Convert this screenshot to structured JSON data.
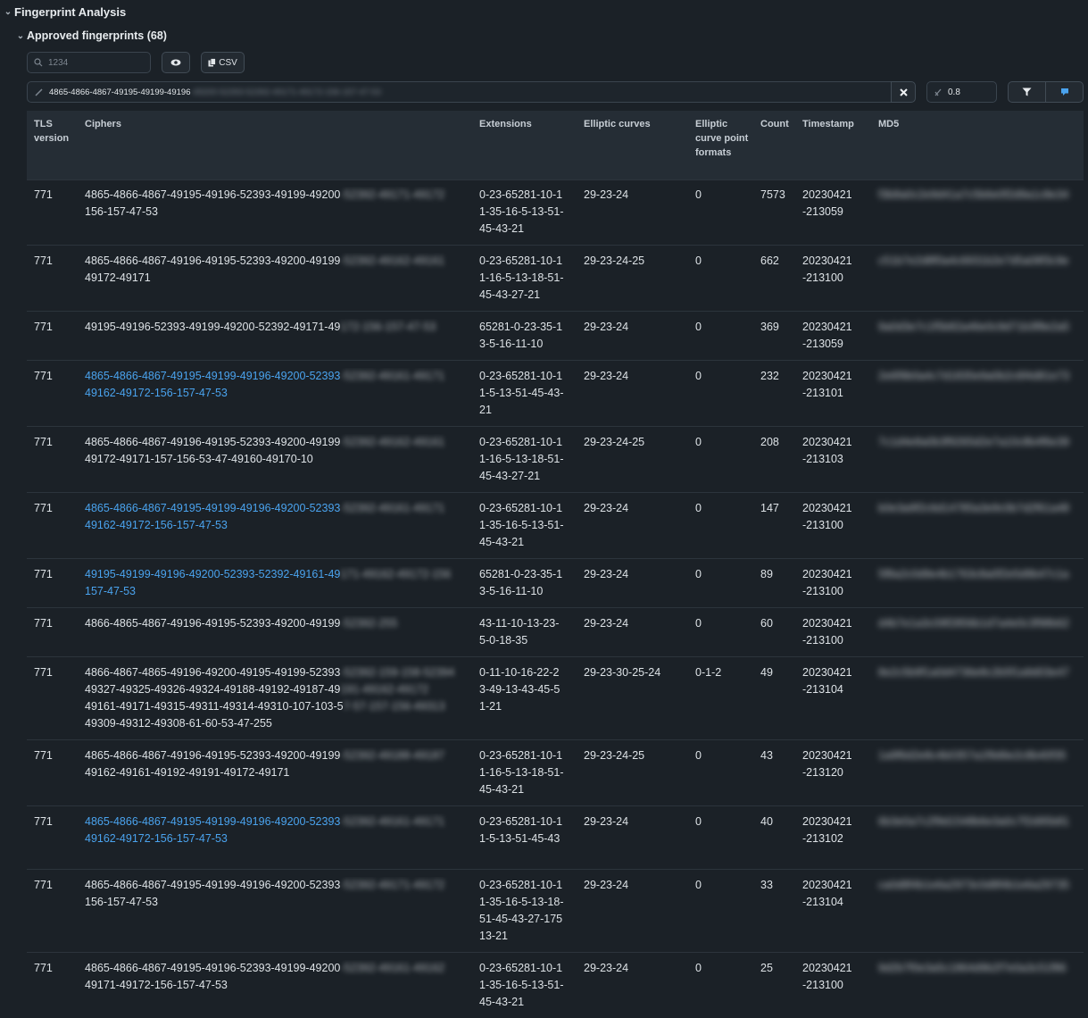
{
  "panel": {
    "title": "Fingerprint Analysis"
  },
  "subpanel": {
    "title": "Approved fingerprints (68)"
  },
  "toolbar": {
    "search_placeholder": "1234",
    "csv_label": "CSV",
    "filter_value": "4865-4866-4867-49195-49199-49196",
    "filter_value_hidden": "-49200-52393-52392-49171-49172-156-157-47-53",
    "threshold_value": "0.8"
  },
  "table": {
    "columns": [
      "TLS version",
      "Ciphers",
      "Extensions",
      "Elliptic curves",
      "Elliptic curve point formats",
      "Count",
      "Timestamp",
      "MD5"
    ],
    "rows": [
      {
        "tls": "771",
        "ciphers": [
          "4865-4866-4867-49195-49196-52393-49199-49200",
          "156-157-47-53"
        ],
        "cipher_hidden": [
          "-52392-49171-49172"
        ],
        "link": false,
        "ext": "0-23-65281-10-11-35-16-5-13-51-45-43-21",
        "curves": "29-23-24",
        "pf": "0",
        "count": "7573",
        "ts": "20230421-213059",
        "md5": "f3b8a0c2e9d41a7c5b6e0f2d9a1c8e34"
      },
      {
        "tls": "771",
        "ciphers": [
          "4865-4866-4867-49196-49195-52393-49200-49199",
          "49172-49171"
        ],
        "cipher_hidden": [
          "-52392-49162-49161"
        ],
        "link": false,
        "ext": "0-23-65281-10-11-16-5-13-18-51-45-43-27-21",
        "curves": "29-23-24-25",
        "pf": "0",
        "count": "662",
        "ts": "20230421-213100",
        "md5": "c51b7e2d8f0a4c6931b2e7d5a08f3c9e"
      },
      {
        "tls": "771",
        "ciphers": [
          "49195-49196-52393-49199-49200-52392-49171-49"
        ],
        "cipher_hidden": [
          "172-156-157-47-53"
        ],
        "link": false,
        "ext": "65281-0-23-35-13-5-16-11-10",
        "curves": "29-23-24",
        "pf": "0",
        "count": "369",
        "ts": "20230421-213059",
        "md5": "9a0d3e7c1f5b82a46e0c9d71b3f8e2a5"
      },
      {
        "tls": "771",
        "ciphers": [
          "4865-4866-4867-49195-49199-49196-49200-52393",
          "49162-49172-156-157-47-53"
        ],
        "cipher_hidden": [
          "-52392-49161-49171"
        ],
        "link": true,
        "ext": "0-23-65281-10-11-5-13-51-45-43-21",
        "curves": "29-23-24",
        "pf": "0",
        "count": "232",
        "ts": "20230421-213101",
        "md5": "2e6f9b0a4c7d1835e9a0b2c6f4d81e73"
      },
      {
        "tls": "771",
        "ciphers": [
          "4865-4866-4867-49196-49195-52393-49200-49199",
          "49172-49171-157-156-53-47-49160-49170-10"
        ],
        "cipher_hidden": [
          "-52392-49162-49161"
        ],
        "link": false,
        "ext": "0-23-65281-10-11-16-5-13-18-51-45-43-27-21",
        "curves": "29-23-24-25",
        "pf": "0",
        "count": "208",
        "ts": "20230421-213103",
        "md5": "7c1d4e8a0b3f9265d2e7a10c8b4f6e39"
      },
      {
        "tls": "771",
        "ciphers": [
          "4865-4866-4867-49195-49199-49196-49200-52393",
          "49162-49172-156-157-47-53"
        ],
        "cipher_hidden": [
          "-52392-49161-49171"
        ],
        "link": true,
        "ext": "0-23-65281-10-11-35-16-5-13-51-45-43-21",
        "curves": "29-23-24",
        "pf": "0",
        "count": "147",
        "ts": "20230421-213100",
        "md5": "b0e3a9f2c6d14785a3e9c0b7d2f61a48"
      },
      {
        "tls": "771",
        "ciphers": [
          "49195-49199-49196-49200-52393-52392-49161-49",
          "157-47-53"
        ],
        "cipher_hidden": [
          "171-49162-49172-156"
        ],
        "link": true,
        "ext": "65281-0-23-35-13-5-16-11-10",
        "curves": "29-23-24",
        "pf": "0",
        "count": "89",
        "ts": "20230421-213100",
        "md5": "5f8a2c0d9e4b1763c8a0f2e5d9b47c1a"
      },
      {
        "tls": "771",
        "ciphers": [
          "4866-4865-4867-49196-49195-52393-49200-49199"
        ],
        "cipher_hidden": [
          "-52392-255"
        ],
        "link": false,
        "ext": "43-11-10-13-23-5-0-18-35",
        "curves": "29-23-24",
        "pf": "0",
        "count": "60",
        "ts": "20230421-213100",
        "md5": "d4b7e1a3c09f2856b1d7a4e0c3f98b62"
      },
      {
        "tls": "771",
        "ciphers": [
          "4866-4867-4865-49196-49200-49195-49199-52393",
          "49327-49325-49326-49324-49188-49192-49187-49",
          "49161-49171-49315-49311-49314-49310-107-103-5",
          "49309-49312-49308-61-60-53-47-255"
        ],
        "cipher_hidden": [
          "-52392-159-158-52394",
          "191-49162-49172",
          "7-57-157-156-49313"
        ],
        "link": false,
        "ext": "0-11-10-16-22-23-49-13-43-45-51-21",
        "curves": "29-23-30-25-24",
        "pf": "0-1-2",
        "count": "49",
        "ts": "20230421-213104",
        "md5": "8e2c5b9f1a0d4736e8c2b5f1a9d03e47"
      },
      {
        "tls": "771",
        "ciphers": [
          "4865-4866-4867-49196-49195-52393-49200-49199",
          "49162-49161-49192-49191-49172-49171"
        ],
        "cipher_hidden": [
          "-52392-49188-49187"
        ],
        "link": false,
        "ext": "0-23-65281-10-11-16-5-13-18-51-45-43-21",
        "curves": "29-23-24-25",
        "pf": "0",
        "count": "43",
        "ts": "20230421-213120",
        "md5": "1a9f6d2e8c4b0357a1f9d6e2c8b40f35"
      },
      {
        "tls": "771",
        "ciphers": [
          "4865-4866-4867-49195-49199-49196-49200-52393",
          "49162-49172-156-157-47-53"
        ],
        "cipher_hidden": [
          "-52392-49161-49171"
        ],
        "link": true,
        "ext": "0-23-65281-10-11-5-13-51-45-43",
        "curves": "29-23-24",
        "pf": "0",
        "count": "40",
        "ts": "20230421-213102",
        "md5": "6b3e0a7c2f9d1548b6e3a0c7f2d95b81"
      },
      {
        "tls": "771",
        "ciphers": [
          "4865-4866-4867-49195-49199-49196-49200-52393",
          "156-157-47-53"
        ],
        "cipher_hidden": [
          "-52392-49171-49172"
        ],
        "link": false,
        "ext": "0-23-65281-10-11-35-16-5-13-18-51-45-43-27-17513-21",
        "curves": "29-23-24",
        "pf": "0",
        "count": "33",
        "ts": "20230421-213104",
        "md5": "ca0d8f4b1e6a2973c0d8f4b1e6a29735"
      },
      {
        "tls": "771",
        "ciphers": [
          "4865-4866-4867-49195-49196-52393-49199-49200",
          "49171-49172-156-157-47-53"
        ],
        "cipher_hidden": [
          "-52392-49161-49162"
        ],
        "link": false,
        "ext": "0-23-65281-10-11-35-16-5-13-51-45-43-21",
        "curves": "29-23-24",
        "pf": "0",
        "count": "25",
        "ts": "20230421-213100",
        "md5": "9d2b7f0e3a5c1864d9b2f7e0a3c51f86"
      }
    ]
  }
}
